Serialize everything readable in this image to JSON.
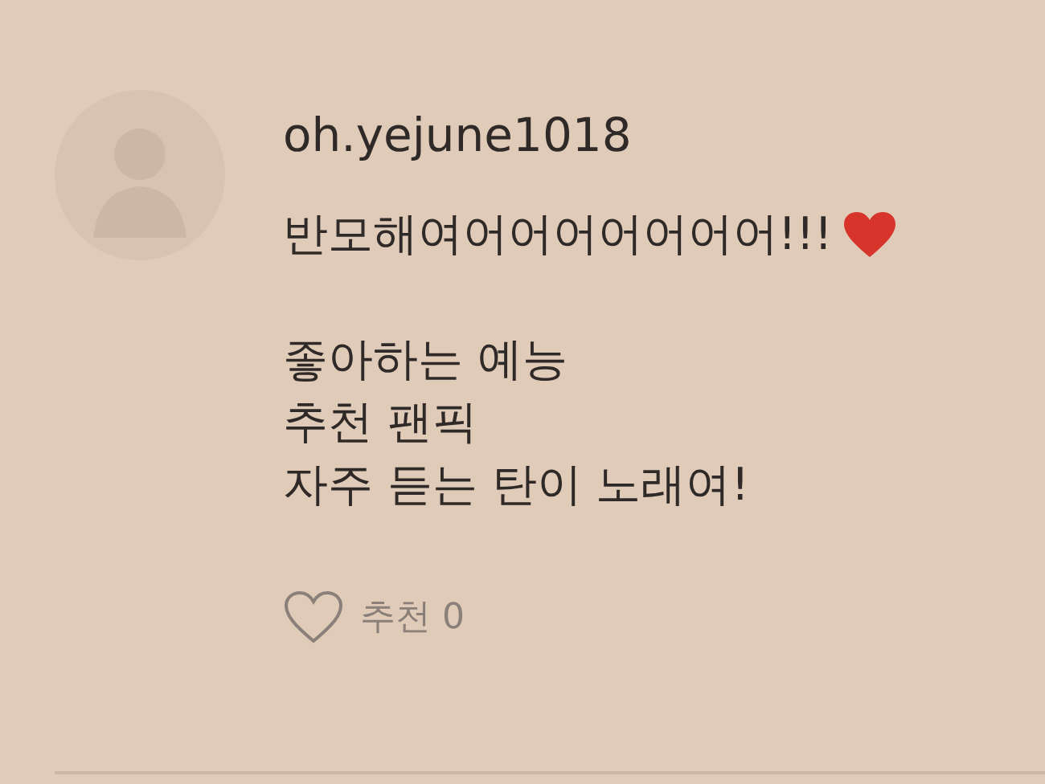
{
  "comment": {
    "author": "oh.yejune1018",
    "headline": "반모해여어어어어어어어!!!",
    "lines": [
      "좋아하는 예능",
      "추천 팬픽",
      "자주 듣는 탄이 노래여!"
    ],
    "recommend": {
      "label": "추천",
      "count": "0",
      "liked": false
    }
  }
}
